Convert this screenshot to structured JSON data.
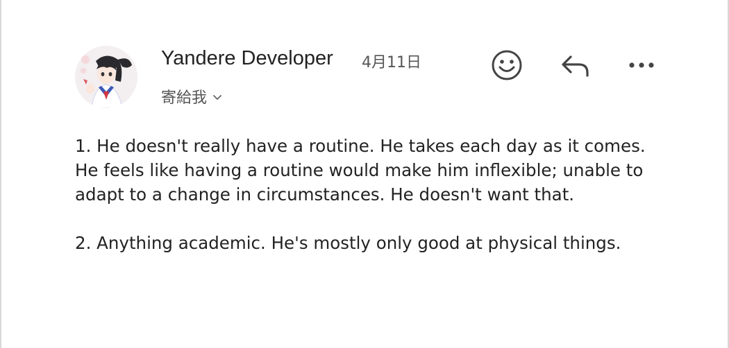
{
  "email": {
    "sender_name": "Yandere Developer",
    "date": "4月11日",
    "recipient_label": "寄給我",
    "paragraphs": [
      "1. He doesn't really have a routine. He takes each day as it comes. He feels like having a routine would make him inflexible; unable to adapt to a change in circumstances. He doesn't want that.",
      "2. Anything academic. He's mostly only good at physical things."
    ]
  },
  "icons": {
    "avatar": "avatar-anime-girl",
    "react": "smiley-face-icon",
    "reply": "reply-arrow-icon",
    "more": "more-horizontal-icon",
    "recipient_toggle": "chevron-down-icon"
  },
  "colors": {
    "text": "#222222",
    "secondary_text": "#555555",
    "icon": "#444444",
    "background": "#ffffff"
  }
}
